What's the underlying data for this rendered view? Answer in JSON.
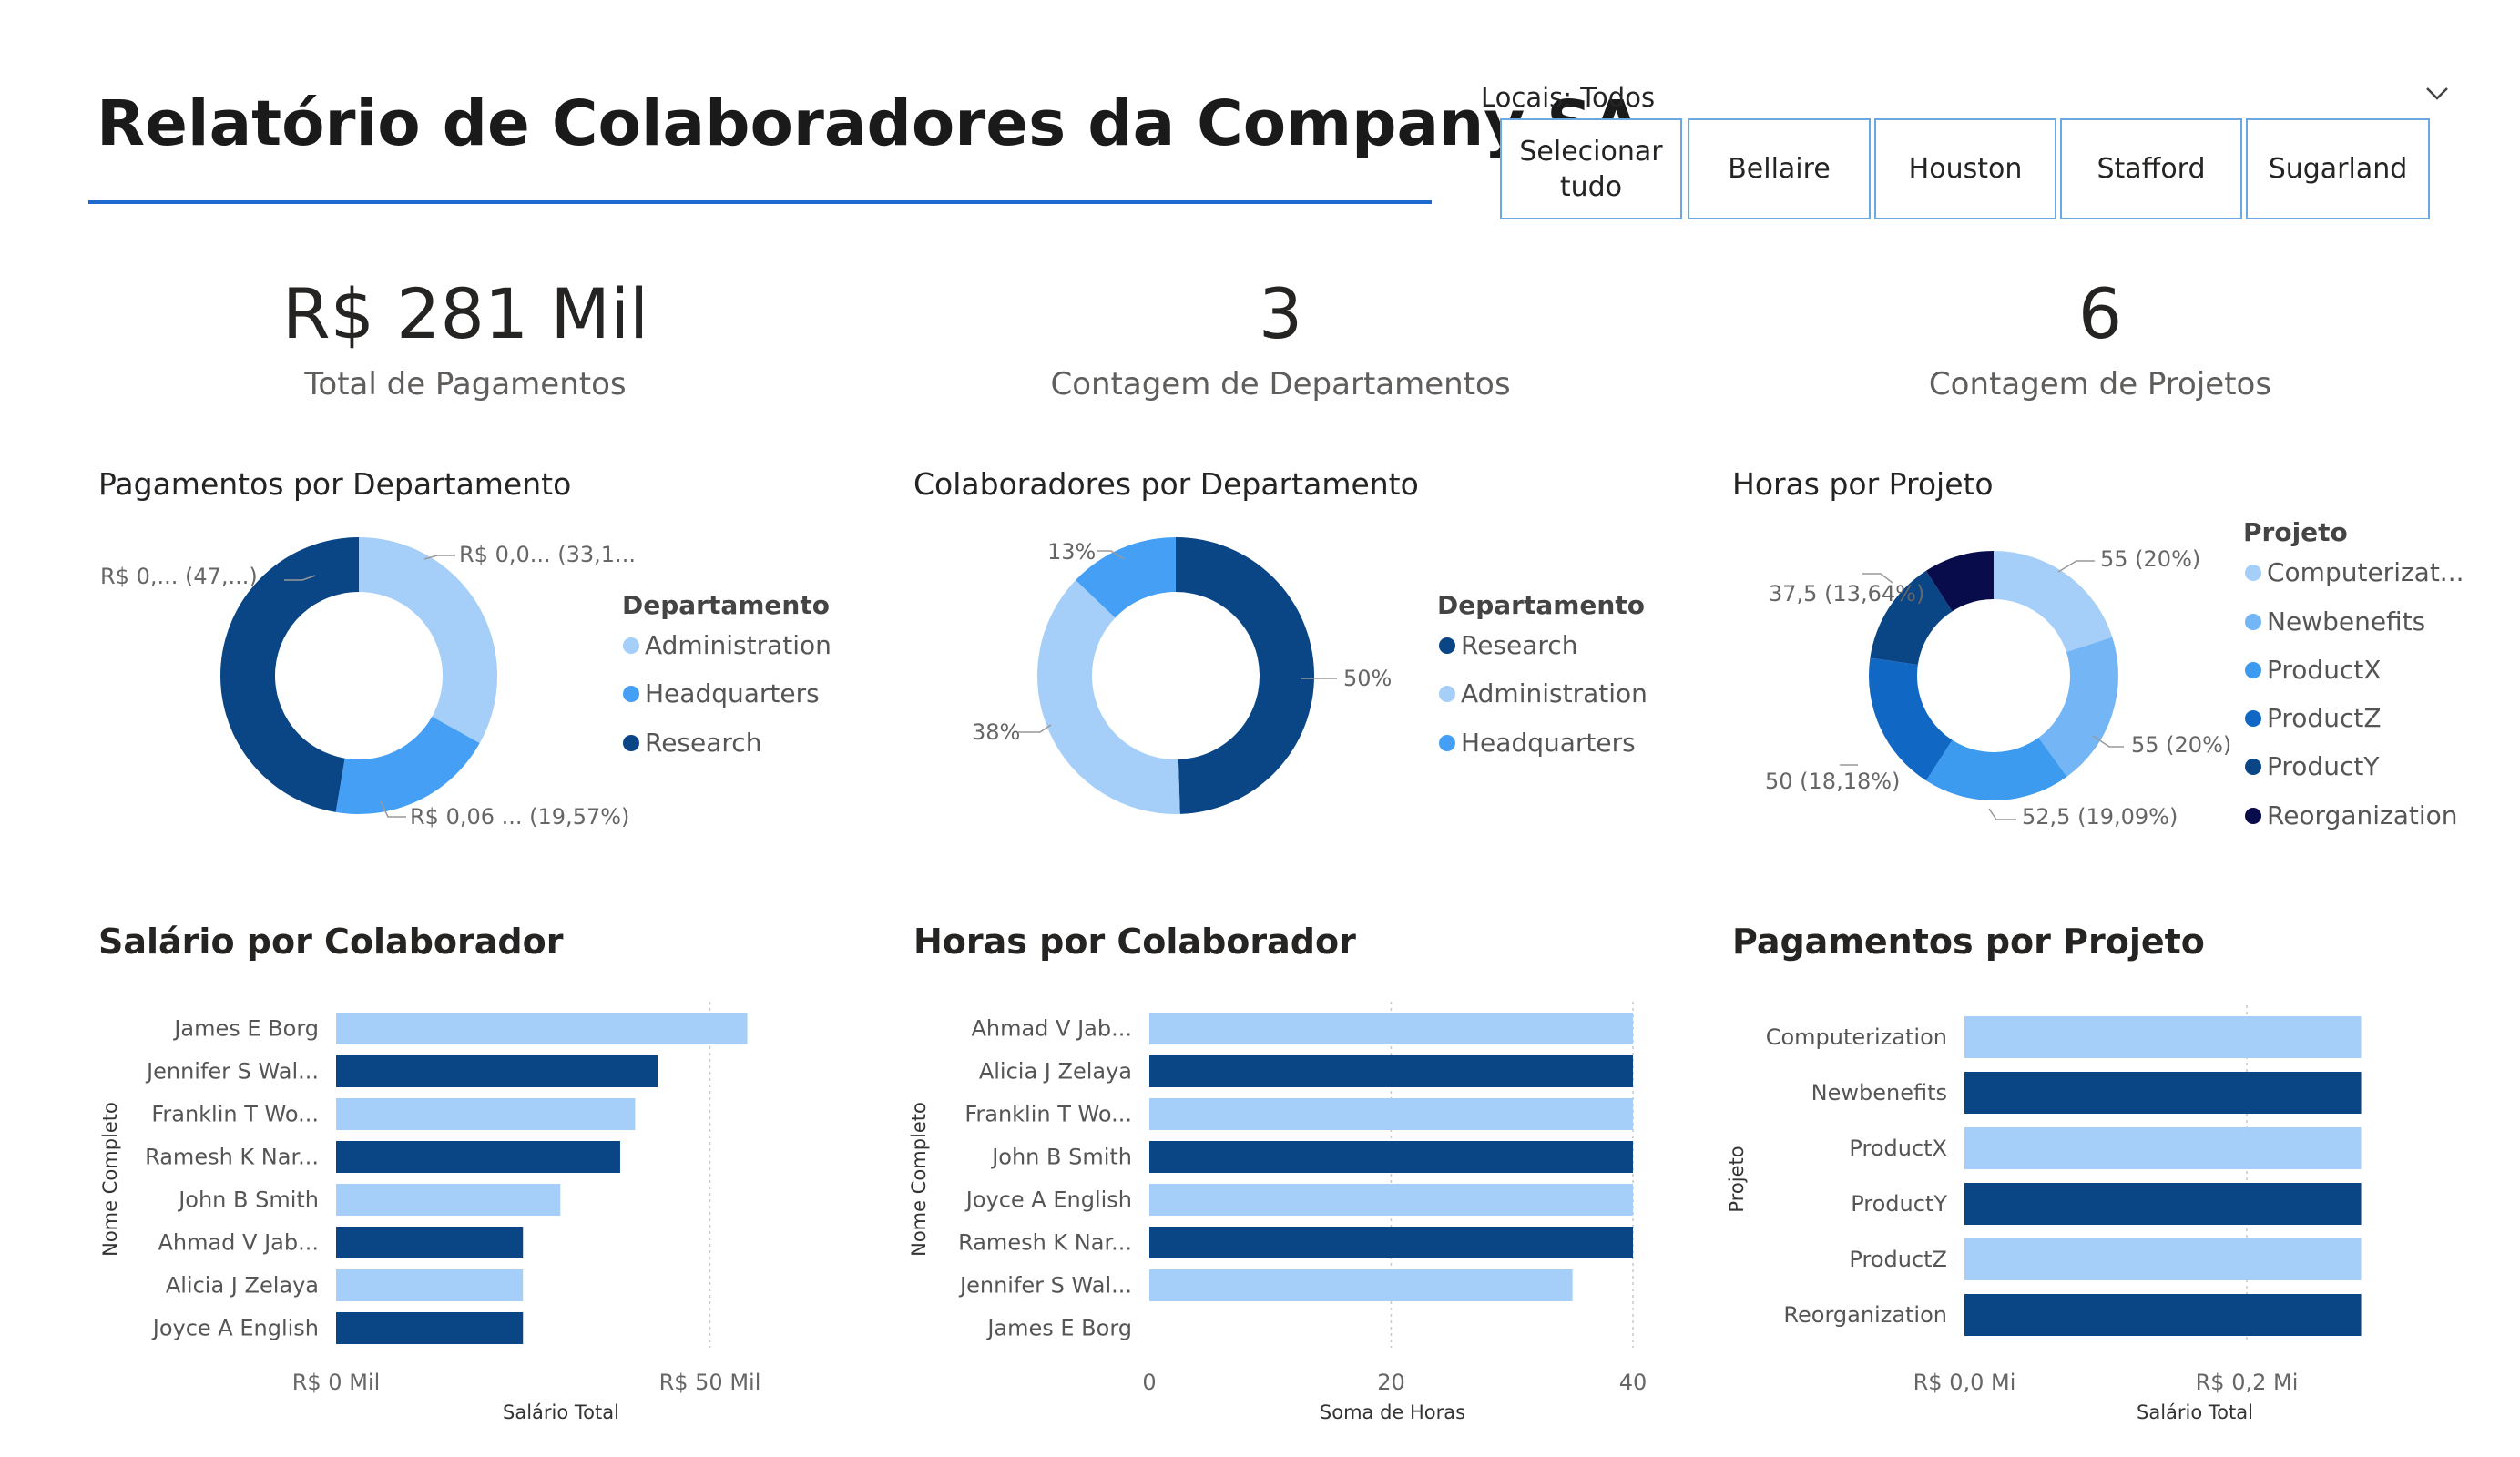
{
  "header": {
    "title": "Relatório de Colaboradores da Company SA"
  },
  "slicer": {
    "label": "Locais: Todos",
    "options": [
      "Selecionar tudo",
      "Bellaire",
      "Houston",
      "Stafford",
      "Sugarland"
    ],
    "chevron_icon": "chevron-down-icon"
  },
  "kpis": [
    {
      "value": "R$ 281 Mil",
      "label": "Total de Pagamentos"
    },
    {
      "value": "3",
      "label": "Contagem de Departamentos"
    },
    {
      "value": "6",
      "label": "Contagem de Projetos"
    }
  ],
  "colors": {
    "light": "#a5cff8",
    "medium": "#45a0f5",
    "bright": "#3d9bef",
    "blue": "#1168c4",
    "dark": "#0a4585",
    "navy": "#080c4a",
    "title_rule": "#1f6ad1",
    "slicer_border": "#6aa7e3"
  },
  "donut_payments_dept": {
    "title": "Pagamentos por Departamento",
    "legend_title": "Departamento",
    "legend": [
      "Administration",
      "Headquarters",
      "Research"
    ],
    "data_labels": [
      "R$ 0,0... (33,1...)",
      "R$ 0,06 ... (19,57%)",
      "R$ 0,... (47,...)"
    ]
  },
  "donut_employees_dept": {
    "title": "Colaboradores por Departamento",
    "legend_title": "Departamento",
    "legend": [
      "Research",
      "Administration",
      "Headquarters"
    ],
    "data_labels": [
      "50%",
      "38%",
      "13%"
    ]
  },
  "donut_hours_project": {
    "title": "Horas por Projeto",
    "legend_title": "Projeto",
    "legend": [
      "Computerizat...",
      "Newbenefits",
      "ProductX",
      "ProductZ",
      "ProductY",
      "Reorganization"
    ],
    "data_labels": [
      "55 (20%)",
      "55 (20%)",
      "52,5 (19,09%)",
      "50 (18,18%)",
      "37,5 (13,64%)",
      ""
    ]
  },
  "bar_salary": {
    "title": "Salário por Colaborador",
    "ylabel": "Nome Completo",
    "xlabel": "Salário Total",
    "categories": [
      "James E Borg",
      "Jennifer S Wal...",
      "Franklin T Wo...",
      "Ramesh K Nar...",
      "John B Smith",
      "Ahmad V Jab...",
      "Alicia J Zelaya",
      "Joyce A English"
    ],
    "ticks": [
      "R$ 0 Mil",
      "R$ 50 Mil"
    ]
  },
  "bar_hours": {
    "title": "Horas por Colaborador",
    "ylabel": "Nome Completo",
    "xlabel": "Soma de Horas",
    "categories": [
      "Ahmad V Jab...",
      "Alicia J Zelaya",
      "Franklin T Wo...",
      "John B Smith",
      "Joyce A English",
      "Ramesh K Nar...",
      "Jennifer S Wal...",
      "James E Borg"
    ],
    "ticks": [
      "0",
      "20",
      "40"
    ]
  },
  "bar_payments_project": {
    "title": "Pagamentos por Projeto",
    "ylabel": "Projeto",
    "xlabel": "Salário Total",
    "categories": [
      "Computerization",
      "Newbenefits",
      "ProductX",
      "ProductY",
      "ProductZ",
      "Reorganization"
    ],
    "ticks": [
      "R$ 0,0 Mi",
      "R$ 0,2 Mi"
    ]
  },
  "chart_data": [
    {
      "type": "pie",
      "title": "Pagamentos por Departamento",
      "categories": [
        "Administration",
        "Headquarters",
        "Research"
      ],
      "values": [
        33.1,
        19.57,
        47.33
      ],
      "unit": "%"
    },
    {
      "type": "pie",
      "title": "Colaboradores por Departamento",
      "categories": [
        "Research",
        "Administration",
        "Headquarters"
      ],
      "values": [
        50,
        38,
        13
      ],
      "unit": "%"
    },
    {
      "type": "pie",
      "title": "Horas por Projeto",
      "categories": [
        "Computerization",
        "Newbenefits",
        "ProductX",
        "ProductZ",
        "ProductY",
        "Reorganization"
      ],
      "values": [
        55,
        55,
        52.5,
        50,
        37.5,
        25
      ]
    },
    {
      "type": "bar",
      "title": "Salário por Colaborador",
      "categories": [
        "James E Borg",
        "Jennifer S Wal...",
        "Franklin T Wo...",
        "Ramesh K Nar...",
        "John B Smith",
        "Ahmad V Jab...",
        "Alicia J Zelaya",
        "Joyce A English"
      ],
      "values": [
        55000,
        43000,
        40000,
        38000,
        30000,
        25000,
        25000,
        25000
      ],
      "xlabel": "Salário Total",
      "ylabel": "Nome Completo",
      "xlim": [
        0,
        62000
      ]
    },
    {
      "type": "bar",
      "title": "Horas por Colaborador",
      "categories": [
        "Ahmad V Jab...",
        "Alicia J Zelaya",
        "Franklin T Wo...",
        "John B Smith",
        "Joyce A English",
        "Ramesh K Nar...",
        "Jennifer S Wal...",
        "James E Borg"
      ],
      "values": [
        40,
        40,
        40,
        40,
        40,
        40,
        35,
        0
      ],
      "xlabel": "Soma de Horas",
      "ylabel": "Nome Completo",
      "xlim": [
        0,
        40
      ]
    },
    {
      "type": "bar",
      "title": "Pagamentos por Projeto",
      "categories": [
        "Computerization",
        "Newbenefits",
        "ProductX",
        "ProductY",
        "ProductZ",
        "Reorganization"
      ],
      "values": [
        281000,
        281000,
        281000,
        281000,
        281000,
        281000
      ],
      "xlabel": "Salário Total",
      "ylabel": "Projeto",
      "xlim": [
        0,
        300000
      ]
    }
  ]
}
